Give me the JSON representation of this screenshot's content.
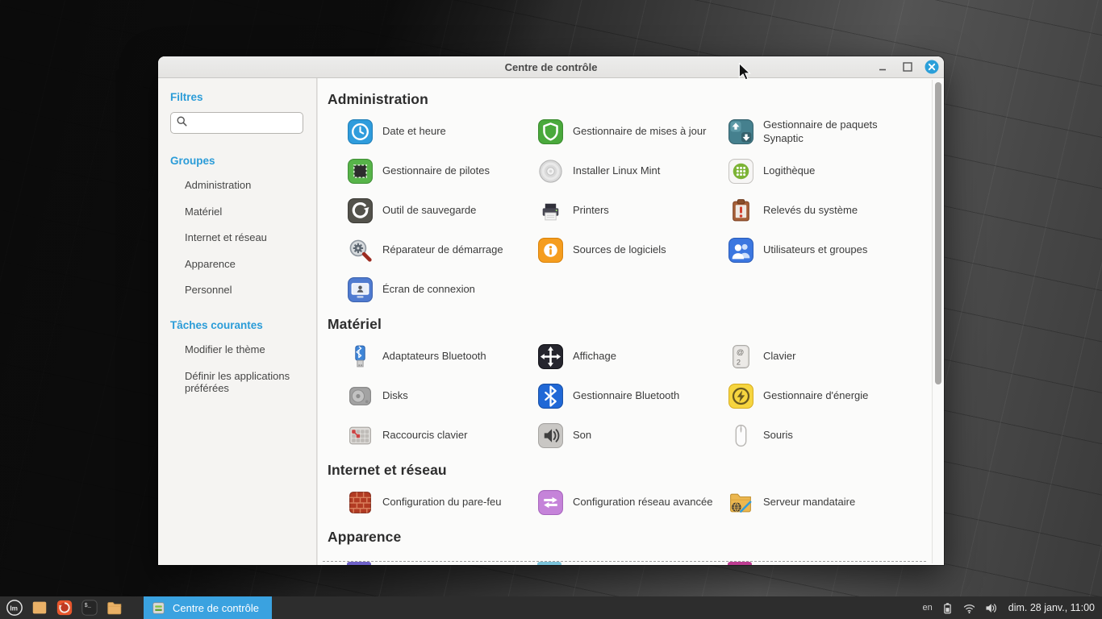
{
  "window": {
    "title": "Centre de contrôle",
    "controls": [
      {
        "name": "minimize-button",
        "icon": "minimize-icon"
      },
      {
        "name": "maximize-button",
        "icon": "maximize-icon"
      },
      {
        "name": "close-button",
        "icon": "close-icon"
      }
    ]
  },
  "sidebar": {
    "filters_title": "Filtres",
    "search": {
      "value": "",
      "placeholder": ""
    },
    "groups_title": "Groupes",
    "groups": [
      "Administration",
      "Matériel",
      "Internet et réseau",
      "Apparence",
      "Personnel"
    ],
    "tasks_title": "Tâches courantes",
    "tasks": [
      "Modifier le thème",
      "Définir les applications préférées"
    ]
  },
  "sections": [
    {
      "title": "Administration",
      "items": [
        {
          "label": "Date et heure",
          "icon": "clock-icon"
        },
        {
          "label": "Gestionnaire de mises à jour",
          "icon": "update-shield-icon"
        },
        {
          "label": "Gestionnaire de paquets Synaptic",
          "icon": "synaptic-icon"
        },
        {
          "label": "Gestionnaire de pilotes",
          "icon": "driver-manager-icon"
        },
        {
          "label": "Installer Linux Mint",
          "icon": "install-cd-icon"
        },
        {
          "label": "Logithèque",
          "icon": "software-manager-icon"
        },
        {
          "label": "Outil de sauvegarde",
          "icon": "backup-icon"
        },
        {
          "label": "Printers",
          "icon": "printer-icon"
        },
        {
          "label": "Relevés du système",
          "icon": "system-reports-icon"
        },
        {
          "label": "Réparateur de démarrage",
          "icon": "boot-repair-icon"
        },
        {
          "label": "Sources de logiciels",
          "icon": "software-sources-icon"
        },
        {
          "label": "Utilisateurs et groupes",
          "icon": "users-groups-icon"
        },
        {
          "label": "Écran de connexion",
          "icon": "login-screen-icon"
        }
      ]
    },
    {
      "title": "Matériel",
      "items": [
        {
          "label": "Adaptateurs Bluetooth",
          "icon": "bluetooth-adapter-icon"
        },
        {
          "label": "Affichage",
          "icon": "display-icon"
        },
        {
          "label": "Clavier",
          "icon": "keyboard-icon"
        },
        {
          "label": "Disks",
          "icon": "disks-icon"
        },
        {
          "label": "Gestionnaire Bluetooth",
          "icon": "bluetooth-manager-icon"
        },
        {
          "label": "Gestionnaire d'énergie",
          "icon": "power-manager-icon"
        },
        {
          "label": "Raccourcis clavier",
          "icon": "keyboard-shortcuts-icon"
        },
        {
          "label": "Son",
          "icon": "sound-icon"
        },
        {
          "label": "Souris",
          "icon": "mouse-icon"
        }
      ]
    },
    {
      "title": "Internet et réseau",
      "items": [
        {
          "label": "Configuration du pare-feu",
          "icon": "firewall-icon"
        },
        {
          "label": "Configuration réseau avancée",
          "icon": "network-advanced-icon"
        },
        {
          "label": "Serveur mandataire",
          "icon": "proxy-icon"
        }
      ]
    },
    {
      "title": "Apparence",
      "items": []
    }
  ],
  "clipped_next_row_colors": [
    "#6f62c8",
    "#7cc3da",
    "#bd3d92"
  ],
  "taskbar": {
    "launchers": [
      {
        "name": "mint-menu-icon"
      },
      {
        "name": "show-desktop-icon"
      },
      {
        "name": "firefox-icon"
      },
      {
        "name": "terminal-icon"
      },
      {
        "name": "files-icon"
      }
    ],
    "active_task": {
      "label": "Centre de contrôle",
      "icon": "control-center-icon"
    },
    "tray": {
      "keyboard_layout": "en",
      "icons": [
        "battery-icon",
        "wifi-icon",
        "volume-icon"
      ],
      "clock": "dim. 28 janv., 11:00"
    }
  },
  "colors": {
    "accent_blue": "#2b9cd8",
    "active_task_bg": "#3aa2e0",
    "close_button": "#2b9fd9"
  }
}
